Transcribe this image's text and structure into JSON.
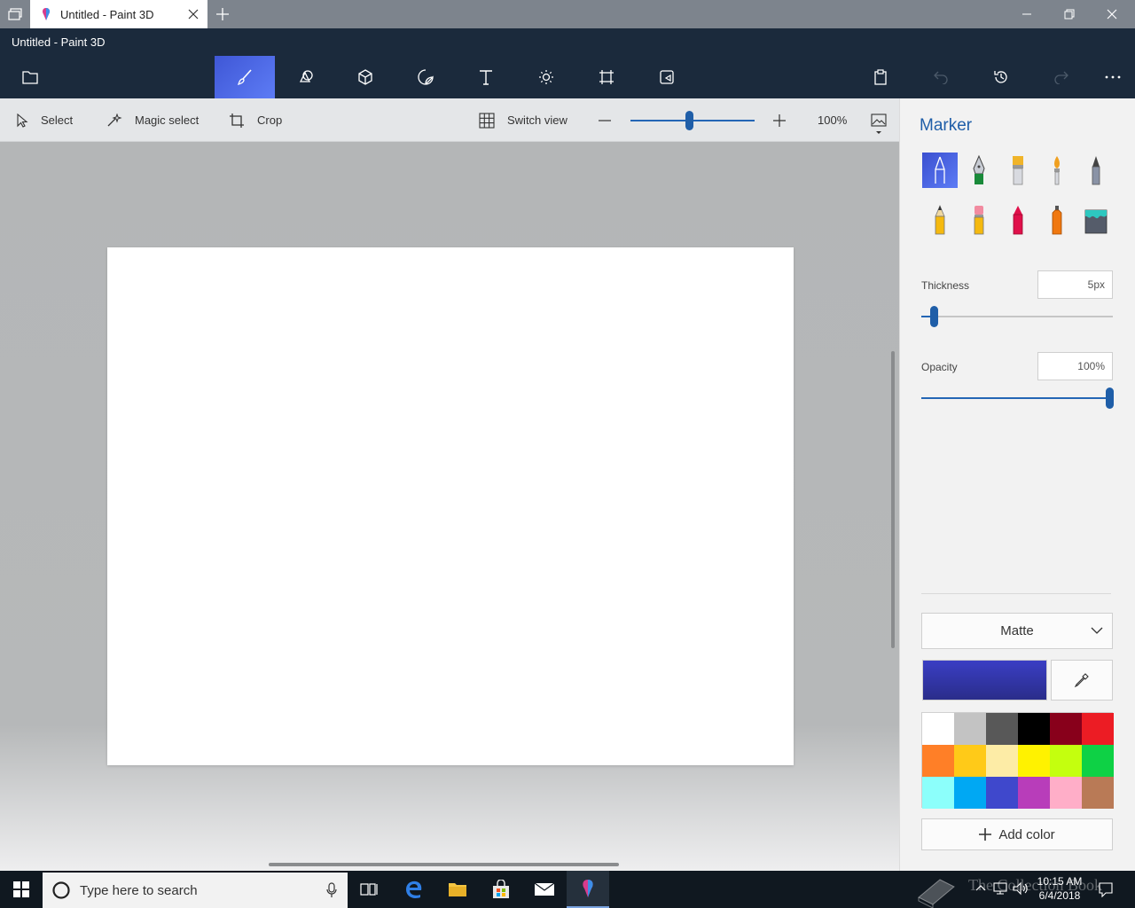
{
  "window": {
    "tab_title": "Untitled - Paint 3D",
    "app_title": "Untitled - Paint 3D"
  },
  "toolbar": {
    "tools": [
      {
        "name": "brushes-tool",
        "icon": "brush-icon",
        "active": true
      },
      {
        "name": "2d-shapes-tool",
        "icon": "shapes-icon",
        "active": false
      },
      {
        "name": "3d-shapes-tool",
        "icon": "cube-icon",
        "active": false
      },
      {
        "name": "stickers-tool",
        "icon": "sticker-icon",
        "active": false
      },
      {
        "name": "text-tool",
        "icon": "text-icon",
        "active": false
      },
      {
        "name": "effects-tool",
        "icon": "sun-icon",
        "active": false
      },
      {
        "name": "canvas-tool",
        "icon": "canvas-icon",
        "active": false
      },
      {
        "name": "3d-library-tool",
        "icon": "library-icon",
        "active": false
      }
    ]
  },
  "subbar": {
    "select": "Select",
    "magic_select": "Magic select",
    "crop": "Crop",
    "switch_view": "Switch view",
    "zoom_level": "100%",
    "zoom_fraction": 0.47
  },
  "panel": {
    "title": "Marker",
    "thickness_label": "Thickness",
    "thickness_value": "5px",
    "thickness_fraction": 0.05,
    "opacity_label": "Opacity",
    "opacity_value": "100%",
    "opacity_fraction": 1.0,
    "finish": "Matte",
    "add_color": "Add color",
    "current_color": "#3a3ec4",
    "palette": [
      "#ffffff",
      "#c3c3c3",
      "#585858",
      "#000000",
      "#88001b",
      "#ec1c24",
      "#ff7f27",
      "#ffca18",
      "#fdeca6",
      "#fff200",
      "#c4ff0e",
      "#0ed145",
      "#8cfffb",
      "#00a8f3",
      "#3f48cc",
      "#b83dba",
      "#ffaec8",
      "#b97a56"
    ]
  },
  "taskbar": {
    "search_placeholder": "Type here to search",
    "time": "10:15 AM",
    "date": "6/4/2018",
    "watermark": "The Collection Book"
  }
}
